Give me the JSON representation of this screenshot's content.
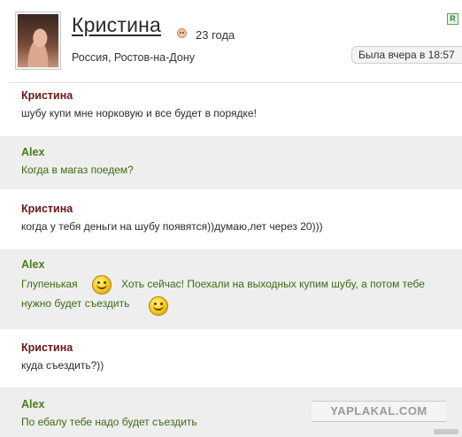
{
  "profile": {
    "name": "Кристина",
    "age": "23 года",
    "location": "Россия, Ростов-на-Дону",
    "badge": "R",
    "last_seen": "Была вчера в 18:57",
    "gender_icon": "female-face-icon"
  },
  "messages": [
    {
      "author": "Кристина",
      "lines": [
        "шубу купи мне норковую и все будет в порядке!"
      ]
    },
    {
      "author": "Alex",
      "lines": [
        "Когда в магаз поедем?"
      ]
    },
    {
      "author": "Кристина",
      "lines": [
        "когда у тебя деньги на шубу появятся))думаю,лет через 20)))"
      ]
    },
    {
      "author": "Alex",
      "lines": [
        "Глупенькая",
        "Хоть сейчас! Поехали на выходных купим шубу, а потом тебе",
        "нужно будет съездить"
      ]
    },
    {
      "author": "Кристина",
      "lines": [
        "куда съездить?))"
      ]
    },
    {
      "author": "Alex",
      "lines": [
        "По ебалу тебе надо будет съездить"
      ]
    }
  ],
  "watermark": "YAPLAKAL.COM",
  "colors": {
    "her_author": "#6b1616",
    "him_author": "#4a7a16",
    "him_text": "#3d6b12",
    "alt_row": "#eeeeee"
  }
}
